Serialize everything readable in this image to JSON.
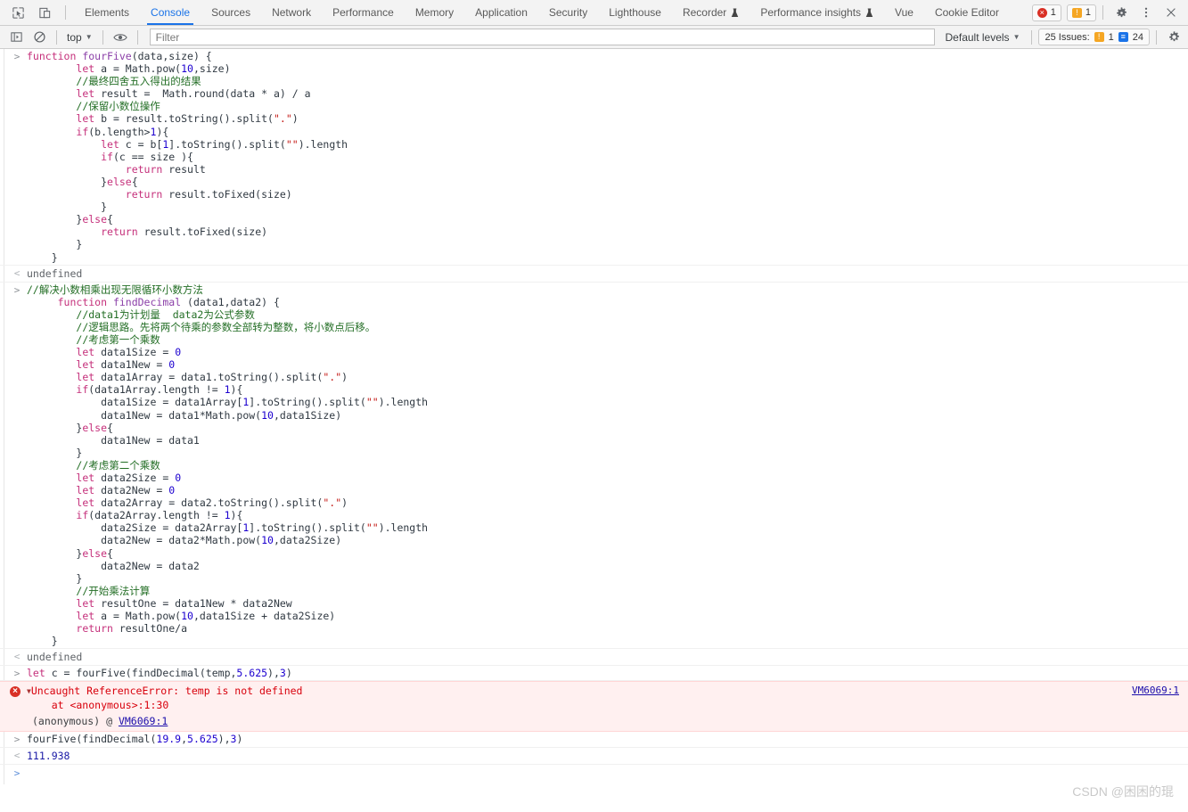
{
  "tabbar": {
    "icons": [
      {
        "name": "inspect-element-icon",
        "title": "Inspect"
      },
      {
        "name": "device-toolbar-icon",
        "title": "Toggle device toolbar"
      }
    ],
    "tabs": [
      {
        "id": "elements",
        "label": "Elements",
        "active": false,
        "preview": false
      },
      {
        "id": "console",
        "label": "Console",
        "active": true,
        "preview": false
      },
      {
        "id": "sources",
        "label": "Sources",
        "active": false,
        "preview": false
      },
      {
        "id": "network",
        "label": "Network",
        "active": false,
        "preview": false
      },
      {
        "id": "performance",
        "label": "Performance",
        "active": false,
        "preview": false
      },
      {
        "id": "memory",
        "label": "Memory",
        "active": false,
        "preview": false
      },
      {
        "id": "application",
        "label": "Application",
        "active": false,
        "preview": false
      },
      {
        "id": "security",
        "label": "Security",
        "active": false,
        "preview": false
      },
      {
        "id": "lighthouse",
        "label": "Lighthouse",
        "active": false,
        "preview": false
      },
      {
        "id": "recorder",
        "label": "Recorder",
        "active": false,
        "preview": true
      },
      {
        "id": "performance-insights",
        "label": "Performance insights",
        "active": false,
        "preview": true
      },
      {
        "id": "vue",
        "label": "Vue",
        "active": false,
        "preview": false
      },
      {
        "id": "cookie-editor",
        "label": "Cookie Editor",
        "active": false,
        "preview": false
      }
    ],
    "error_count": "1",
    "warning_count": "1",
    "settings_icon": "gear-icon",
    "more_icon": "kebab-menu-icon",
    "close_icon": "close-icon"
  },
  "console_toolbar": {
    "clear_icon": "clear-console-icon",
    "sidebar_icon": "console-sidebar-icon",
    "context": "top",
    "eye_icon": "live-expression-eye-icon",
    "filter_placeholder": "Filter",
    "filter_value": "",
    "levels_label": "Default levels",
    "issues_label": "25 Issues:",
    "issues_warning_count": "1",
    "issues_info_count": "24",
    "settings_icon": "gear-icon"
  },
  "console": {
    "entries": [
      {
        "kind": "input",
        "gutter": ">",
        "lines": [
          [
            {
              "t": "kw",
              "v": "function "
            },
            {
              "t": "fn",
              "v": "fourFive"
            },
            {
              "t": "pln",
              "v": "(data,size) {"
            }
          ],
          [
            {
              "t": "pln",
              "v": "        "
            },
            {
              "t": "kw",
              "v": "let"
            },
            {
              "t": "pln",
              "v": " a = Math.pow("
            },
            {
              "t": "num",
              "v": "10"
            },
            {
              "t": "pln",
              "v": ",size)"
            }
          ],
          [
            {
              "t": "pln",
              "v": "        "
            },
            {
              "t": "cmt",
              "v": "//最终四舍五入得出的结果"
            }
          ],
          [
            {
              "t": "pln",
              "v": "        "
            },
            {
              "t": "kw",
              "v": "let"
            },
            {
              "t": "pln",
              "v": " result =  Math.round(data * a) / a"
            }
          ],
          [
            {
              "t": "pln",
              "v": "        "
            },
            {
              "t": "cmt",
              "v": "//保留小数位操作"
            }
          ],
          [
            {
              "t": "pln",
              "v": "        "
            },
            {
              "t": "kw",
              "v": "let"
            },
            {
              "t": "pln",
              "v": " b = result.toString().split("
            },
            {
              "t": "str",
              "v": "\".\""
            },
            {
              "t": "pln",
              "v": ")"
            }
          ],
          [
            {
              "t": "pln",
              "v": "        "
            },
            {
              "t": "kw",
              "v": "if"
            },
            {
              "t": "pln",
              "v": "(b.length>"
            },
            {
              "t": "num",
              "v": "1"
            },
            {
              "t": "pln",
              "v": "){"
            }
          ],
          [
            {
              "t": "pln",
              "v": "            "
            },
            {
              "t": "kw",
              "v": "let"
            },
            {
              "t": "pln",
              "v": " c = b["
            },
            {
              "t": "num",
              "v": "1"
            },
            {
              "t": "pln",
              "v": "].toString().split("
            },
            {
              "t": "str",
              "v": "\"\""
            },
            {
              "t": "pln",
              "v": ").length"
            }
          ],
          [
            {
              "t": "pln",
              "v": "            "
            },
            {
              "t": "kw",
              "v": "if"
            },
            {
              "t": "pln",
              "v": "(c == size ){"
            }
          ],
          [
            {
              "t": "pln",
              "v": "                "
            },
            {
              "t": "kw",
              "v": "return"
            },
            {
              "t": "pln",
              "v": " result"
            }
          ],
          [
            {
              "t": "pln",
              "v": "            }"
            },
            {
              "t": "kw",
              "v": "else"
            },
            {
              "t": "pln",
              "v": "{"
            }
          ],
          [
            {
              "t": "pln",
              "v": "                "
            },
            {
              "t": "kw",
              "v": "return"
            },
            {
              "t": "pln",
              "v": " result.toFixed(size)"
            }
          ],
          [
            {
              "t": "pln",
              "v": "            }"
            }
          ],
          [
            {
              "t": "pln",
              "v": "        }"
            },
            {
              "t": "kw",
              "v": "else"
            },
            {
              "t": "pln",
              "v": "{"
            }
          ],
          [
            {
              "t": "pln",
              "v": "            "
            },
            {
              "t": "kw",
              "v": "return"
            },
            {
              "t": "pln",
              "v": " result.toFixed(size)"
            }
          ],
          [
            {
              "t": "pln",
              "v": "        }"
            }
          ],
          [
            {
              "t": "pln",
              "v": "    }"
            }
          ]
        ]
      },
      {
        "kind": "output",
        "gutter": "<",
        "text": "undefined",
        "style": "undefined"
      },
      {
        "kind": "input",
        "gutter": ">",
        "lines": [
          [
            {
              "t": "cmt",
              "v": "//解决小数相乘出现无限循环小数方法"
            }
          ],
          [
            {
              "t": "pln",
              "v": "     "
            },
            {
              "t": "kw",
              "v": "function "
            },
            {
              "t": "fn",
              "v": "findDecimal"
            },
            {
              "t": "pln",
              "v": " (data1,data2) {"
            }
          ],
          [
            {
              "t": "pln",
              "v": "        "
            },
            {
              "t": "cmt",
              "v": "//data1为计划量  data2为公式参数"
            }
          ],
          [
            {
              "t": "pln",
              "v": "        "
            },
            {
              "t": "cmt",
              "v": "//逻辑思路。先将两个待乘的参数全部转为整数，将小数点后移。"
            }
          ],
          [
            {
              "t": "pln",
              "v": "        "
            },
            {
              "t": "cmt",
              "v": "//考虑第一个乘数"
            }
          ],
          [
            {
              "t": "pln",
              "v": "        "
            },
            {
              "t": "kw",
              "v": "let"
            },
            {
              "t": "pln",
              "v": " data1Size = "
            },
            {
              "t": "num",
              "v": "0"
            }
          ],
          [
            {
              "t": "pln",
              "v": "        "
            },
            {
              "t": "kw",
              "v": "let"
            },
            {
              "t": "pln",
              "v": " data1New = "
            },
            {
              "t": "num",
              "v": "0"
            }
          ],
          [
            {
              "t": "pln",
              "v": "        "
            },
            {
              "t": "kw",
              "v": "let"
            },
            {
              "t": "pln",
              "v": " data1Array = data1.toString().split("
            },
            {
              "t": "str",
              "v": "\".\""
            },
            {
              "t": "pln",
              "v": ")"
            }
          ],
          [
            {
              "t": "pln",
              "v": "        "
            },
            {
              "t": "kw",
              "v": "if"
            },
            {
              "t": "pln",
              "v": "(data1Array.length != "
            },
            {
              "t": "num",
              "v": "1"
            },
            {
              "t": "pln",
              "v": "){"
            }
          ],
          [
            {
              "t": "pln",
              "v": "            data1Size = data1Array["
            },
            {
              "t": "num",
              "v": "1"
            },
            {
              "t": "pln",
              "v": "].toString().split("
            },
            {
              "t": "str",
              "v": "\"\""
            },
            {
              "t": "pln",
              "v": ").length"
            }
          ],
          [
            {
              "t": "pln",
              "v": "            data1New = data1*Math.pow("
            },
            {
              "t": "num",
              "v": "10"
            },
            {
              "t": "pln",
              "v": ",data1Size)"
            }
          ],
          [
            {
              "t": "pln",
              "v": "        }"
            },
            {
              "t": "kw",
              "v": "else"
            },
            {
              "t": "pln",
              "v": "{"
            }
          ],
          [
            {
              "t": "pln",
              "v": "            data1New = data1"
            }
          ],
          [
            {
              "t": "pln",
              "v": "        }"
            }
          ],
          [
            {
              "t": "pln",
              "v": "        "
            },
            {
              "t": "cmt",
              "v": "//考虑第二个乘数"
            }
          ],
          [
            {
              "t": "pln",
              "v": "        "
            },
            {
              "t": "kw",
              "v": "let"
            },
            {
              "t": "pln",
              "v": " data2Size = "
            },
            {
              "t": "num",
              "v": "0"
            }
          ],
          [
            {
              "t": "pln",
              "v": "        "
            },
            {
              "t": "kw",
              "v": "let"
            },
            {
              "t": "pln",
              "v": " data2New = "
            },
            {
              "t": "num",
              "v": "0"
            }
          ],
          [
            {
              "t": "pln",
              "v": "        "
            },
            {
              "t": "kw",
              "v": "let"
            },
            {
              "t": "pln",
              "v": " data2Array = data2.toString().split("
            },
            {
              "t": "str",
              "v": "\".\""
            },
            {
              "t": "pln",
              "v": ")"
            }
          ],
          [
            {
              "t": "pln",
              "v": "        "
            },
            {
              "t": "kw",
              "v": "if"
            },
            {
              "t": "pln",
              "v": "(data2Array.length != "
            },
            {
              "t": "num",
              "v": "1"
            },
            {
              "t": "pln",
              "v": "){"
            }
          ],
          [
            {
              "t": "pln",
              "v": "            data2Size = data2Array["
            },
            {
              "t": "num",
              "v": "1"
            },
            {
              "t": "pln",
              "v": "].toString().split("
            },
            {
              "t": "str",
              "v": "\"\""
            },
            {
              "t": "pln",
              "v": ").length"
            }
          ],
          [
            {
              "t": "pln",
              "v": "            data2New = data2*Math.pow("
            },
            {
              "t": "num",
              "v": "10"
            },
            {
              "t": "pln",
              "v": ",data2Size)"
            }
          ],
          [
            {
              "t": "pln",
              "v": "        }"
            },
            {
              "t": "kw",
              "v": "else"
            },
            {
              "t": "pln",
              "v": "{"
            }
          ],
          [
            {
              "t": "pln",
              "v": "            data2New = data2"
            }
          ],
          [
            {
              "t": "pln",
              "v": "        }"
            }
          ],
          [
            {
              "t": "pln",
              "v": "        "
            },
            {
              "t": "cmt",
              "v": "//开始乘法计算"
            }
          ],
          [
            {
              "t": "pln",
              "v": "        "
            },
            {
              "t": "kw",
              "v": "let"
            },
            {
              "t": "pln",
              "v": " resultOne = data1New * data2New"
            }
          ],
          [
            {
              "t": "pln",
              "v": "        "
            },
            {
              "t": "kw",
              "v": "let"
            },
            {
              "t": "pln",
              "v": " a = Math.pow("
            },
            {
              "t": "num",
              "v": "10"
            },
            {
              "t": "pln",
              "v": ",data1Size + data2Size)"
            }
          ],
          [
            {
              "t": "pln",
              "v": "        "
            },
            {
              "t": "kw",
              "v": "return"
            },
            {
              "t": "pln",
              "v": " resultOne/a"
            }
          ],
          [
            {
              "t": "pln",
              "v": "    }"
            }
          ]
        ]
      },
      {
        "kind": "output",
        "gutter": "<",
        "text": "undefined",
        "style": "undefined"
      },
      {
        "kind": "input",
        "gutter": ">",
        "lines": [
          [
            {
              "t": "kw",
              "v": "let"
            },
            {
              "t": "pln",
              "v": " c = fourFive(findDecimal(temp,"
            },
            {
              "t": "num",
              "v": "5.625"
            },
            {
              "t": "pln",
              "v": "),"
            },
            {
              "t": "num",
              "v": "3"
            },
            {
              "t": "pln",
              "v": ")"
            }
          ]
        ]
      },
      {
        "kind": "error",
        "title": "Uncaught ReferenceError: temp is not defined",
        "stack_line": "    at <anonymous>:1:30",
        "frame_prefix": "(anonymous) @ ",
        "frame_link": "VM6069:1",
        "source_link": "VM6069:1",
        "expanded": true
      },
      {
        "kind": "input",
        "gutter": ">",
        "lines": [
          [
            {
              "t": "pln",
              "v": "fourFive(findDecimal("
            },
            {
              "t": "num",
              "v": "19.9"
            },
            {
              "t": "pln",
              "v": ","
            },
            {
              "t": "num",
              "v": "5.625"
            },
            {
              "t": "pln",
              "v": "),"
            },
            {
              "t": "num",
              "v": "3"
            },
            {
              "t": "pln",
              "v": ")"
            }
          ]
        ]
      },
      {
        "kind": "output",
        "gutter": "<",
        "text": "111.938",
        "style": "number"
      }
    ],
    "prompt_caret": ">",
    "prompt_value": ""
  },
  "watermark": "CSDN @困困的琨",
  "colors": {
    "accent": "#1a73e8",
    "error": "#d93025",
    "warning": "#f5a623",
    "comment": "#236e25",
    "keyword": "#c5307b",
    "number": "#1c00cf",
    "string": "#c41a16"
  }
}
